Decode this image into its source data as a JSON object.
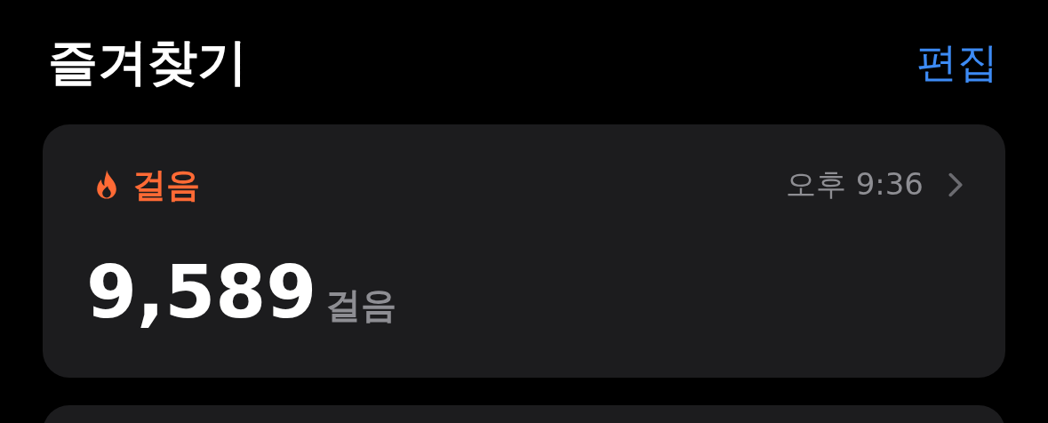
{
  "header": {
    "title": "즐겨찾기",
    "edit_link": "편집"
  },
  "cards": [
    {
      "kind": "metric",
      "category": "걸음",
      "time": "오후 9:36",
      "value": "9,589",
      "unit": "걸음"
    },
    {
      "kind": "empty"
    }
  ]
}
